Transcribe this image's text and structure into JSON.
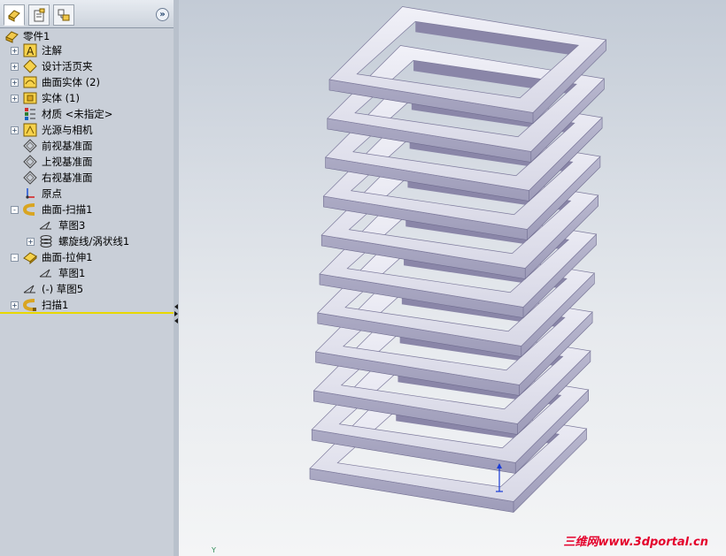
{
  "feature_tree": {
    "root_label": "零件1",
    "items": [
      {
        "label": "注解",
        "icon": "annotations-icon",
        "expander": "+"
      },
      {
        "label": "设计活页夹",
        "icon": "design-binder-icon",
        "expander": "+"
      },
      {
        "label": "曲面实体 (2)",
        "icon": "surface-bodies-icon",
        "expander": "+"
      },
      {
        "label": "实体 (1)",
        "icon": "solid-bodies-icon",
        "expander": "+"
      },
      {
        "label": "材质 <未指定>",
        "icon": "material-icon",
        "expander": ""
      },
      {
        "label": "光源与相机",
        "icon": "lights-cameras-icon",
        "expander": "+"
      },
      {
        "label": "前视基准面",
        "icon": "plane-icon",
        "expander": ""
      },
      {
        "label": "上视基准面",
        "icon": "plane-icon",
        "expander": ""
      },
      {
        "label": "右视基准面",
        "icon": "plane-icon",
        "expander": ""
      },
      {
        "label": "原点",
        "icon": "origin-icon",
        "expander": ""
      },
      {
        "label": "曲面-扫描1",
        "icon": "surface-sweep-icon",
        "expander": "-"
      },
      {
        "label": "草图3",
        "icon": "sketch-icon",
        "expander": ""
      },
      {
        "label": "螺旋线/涡状线1",
        "icon": "helix-icon",
        "expander": "+"
      },
      {
        "label": "曲面-拉伸1",
        "icon": "surface-extrude-icon",
        "expander": "-"
      },
      {
        "label": "草图1",
        "icon": "sketch-icon",
        "expander": ""
      },
      {
        "label": "(-)  草图5",
        "icon": "sketch-icon",
        "expander": ""
      },
      {
        "label": "扫描1",
        "icon": "sweep-icon",
        "expander": "+"
      }
    ]
  },
  "tabs": [
    "feature-manager",
    "property-manager",
    "configuration-manager"
  ],
  "expand_button": "»",
  "viewport": {
    "watermark": "三维网www.3dportal.cn",
    "axis_label": "Y"
  }
}
